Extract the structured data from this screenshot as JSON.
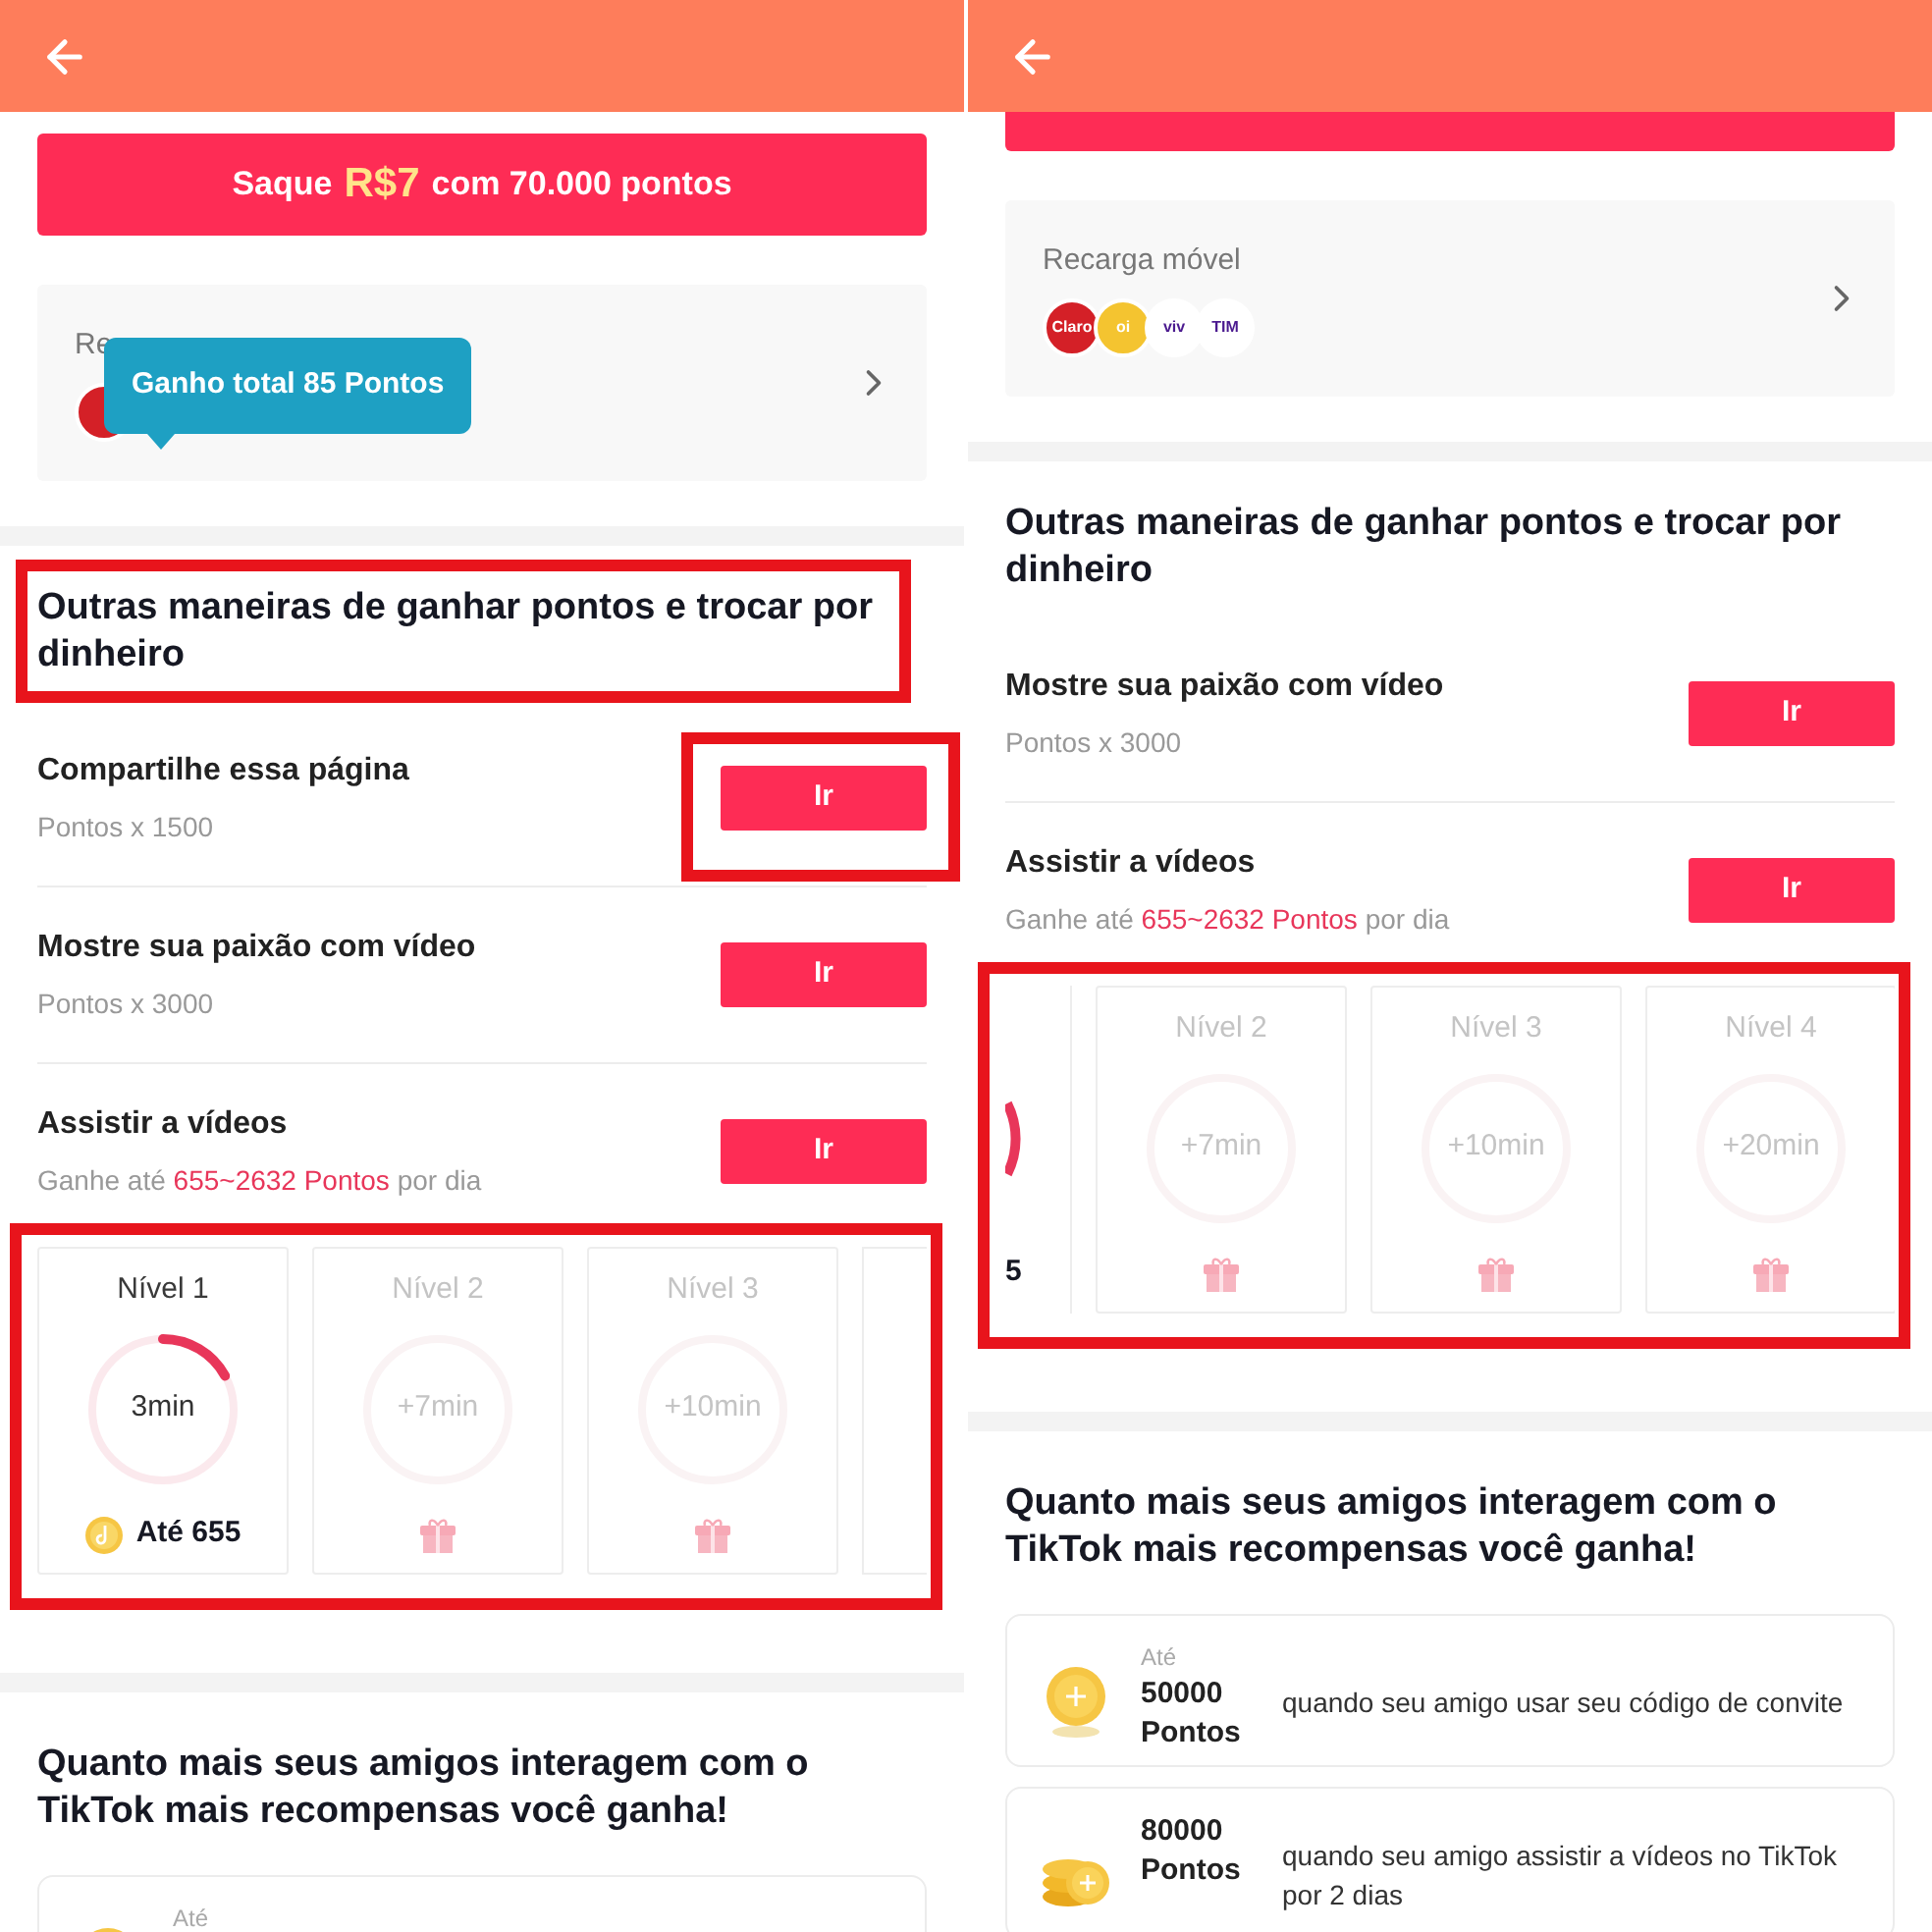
{
  "screens": [
    {
      "withdraw": {
        "cut": false,
        "prefix": "Saque",
        "amount": "R$7",
        "suffix": "com 70.000 pontos"
      },
      "recharge": {
        "label": "Re",
        "operators": [
          {
            "color": "#d42027"
          }
        ],
        "tooltip": "Ganho total 85 Pontos"
      },
      "other_ways": {
        "title": "Outras maneiras de ganhar pontos e trocar por dinheiro",
        "annotated": true,
        "tasks": [
          {
            "title": "Compartilhe essa página",
            "subtitle": [
              {
                "text": "Pontos x 1500",
                "highlight": false
              }
            ],
            "button": "Ir",
            "annotated": true
          },
          {
            "title": "Mostre sua paixão com vídeo",
            "subtitle": [
              {
                "text": "Pontos x 3000",
                "highlight": false
              }
            ],
            "button": "Ir"
          },
          {
            "title": "Assistir a vídeos",
            "subtitle": [
              {
                "text": "Ganhe até",
                "highlight": false
              },
              {
                "text": "655~2632 Pontos",
                "highlight": true
              },
              {
                "text": "por dia",
                "highlight": false
              }
            ],
            "button": "Ir"
          }
        ],
        "levels": {
          "annotated": true,
          "cards": [
            {
              "kind": "full",
              "label": "Nível 1",
              "time": "3min",
              "active": true,
              "level": 0.17,
              "reward": "Até 655"
            },
            {
              "kind": "full",
              "label": "Nível 2",
              "time": "+7min",
              "active": false
            },
            {
              "kind": "full",
              "label": "Nível 3",
              "time": "+10min",
              "active": false
            },
            {
              "kind": "edge_right"
            }
          ]
        }
      },
      "friends": {
        "title": "Quanto mais seus amigos interagem com o TikTok mais recompensas você ganha!",
        "rewards": [
          {
            "kind": "single_coin",
            "prefix": "Até"
          }
        ]
      }
    },
    {
      "withdraw": {
        "cut": true
      },
      "recharge": {
        "label": "Recarga móvel",
        "operators": [
          {
            "name": "Claro",
            "color": "#d42027"
          },
          {
            "name": "oi",
            "color": "#f4c430"
          },
          {
            "name": "viv",
            "color": "#ffffff"
          },
          {
            "name": "TIM",
            "color": "#ffffff"
          }
        ]
      },
      "other_ways": {
        "title": "Outras maneiras de ganhar pontos e trocar por dinheiro",
        "annotated": false,
        "tasks": [
          {
            "title": "Mostre sua paixão com vídeo",
            "subtitle": [
              {
                "text": "Pontos x 3000",
                "highlight": false
              }
            ],
            "button": "Ir"
          },
          {
            "title": "Assistir a vídeos",
            "subtitle": [
              {
                "text": "Ganhe até",
                "highlight": false
              },
              {
                "text": "655~2632 Pontos",
                "highlight": true
              },
              {
                "text": "por dia",
                "highlight": false
              }
            ],
            "button": "Ir"
          }
        ],
        "levels": {
          "annotated": true,
          "cards": [
            {
              "kind": "edge_left",
              "reward": "5"
            },
            {
              "kind": "full",
              "label": "Nível 2",
              "time": "+7min",
              "active": false
            },
            {
              "kind": "full",
              "label": "Nível 3",
              "time": "+10min",
              "active": false
            },
            {
              "kind": "full",
              "label": "Nível 4",
              "time": "+20min",
              "active": false
            }
          ]
        }
      },
      "friends": {
        "title": "Quanto mais seus amigos interagem com o TikTok mais recompensas você ganha!",
        "rewards": [
          {
            "kind": "single_coin",
            "prefix": "Até",
            "points": "50000",
            "unit": "Pontos",
            "description": "quando seu amigo usar seu código de convite"
          },
          {
            "kind": "coin_stack",
            "points": "80000",
            "unit": "Pontos",
            "description": "quando seu amigo assistir a vídeos no TikTok por 2 dias"
          }
        ]
      }
    }
  ]
}
